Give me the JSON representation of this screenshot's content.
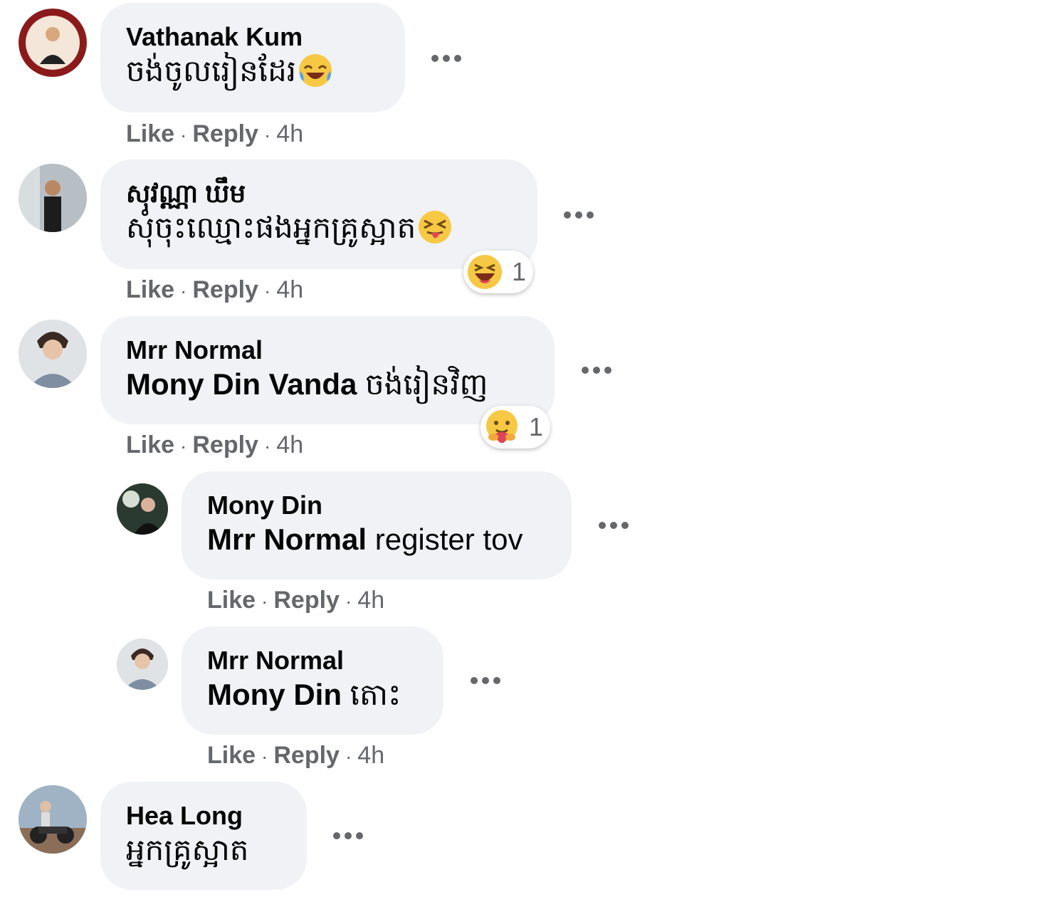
{
  "comments": [
    {
      "author": "Vathanak Kum",
      "text": "ចង់ចូលរៀនដែរ",
      "emoji_icon": "laughing-tears-emoji-icon",
      "like": "Like",
      "reply": "Reply",
      "time": "4h"
    },
    {
      "author": "សុវណ្ណា ឃឹម",
      "text": "សុំចុះឈ្មោះផងអ្នកគ្រូស្អាត",
      "emoji_icon": "squinting-tongue-emoji-icon",
      "like": "Like",
      "reply": "Reply",
      "time": "4h",
      "reaction": {
        "icon": "haha-reaction-icon",
        "count": "1"
      }
    },
    {
      "author": "Mrr Normal",
      "mention": "Mony Din Vanda",
      "text": " ចង់រៀនវិញ",
      "like": "Like",
      "reply": "Reply",
      "time": "4h",
      "reaction": {
        "icon": "care-reaction-icon",
        "count": "1"
      }
    },
    {
      "author": "Mony Din",
      "mention": "Mrr Normal",
      "text": " register tov",
      "like": "Like",
      "reply": "Reply",
      "time": "4h"
    },
    {
      "author": "Mrr Normal",
      "mention": "Mony Din",
      "text": " តោះ",
      "like": "Like",
      "reply": "Reply",
      "time": "4h"
    },
    {
      "author": "Hea Long",
      "text": "អ្នកគ្រូស្អាត"
    }
  ],
  "colors": {
    "bubble": "#f0f2f5",
    "meta_text": "#65676b",
    "text": "#050505"
  }
}
